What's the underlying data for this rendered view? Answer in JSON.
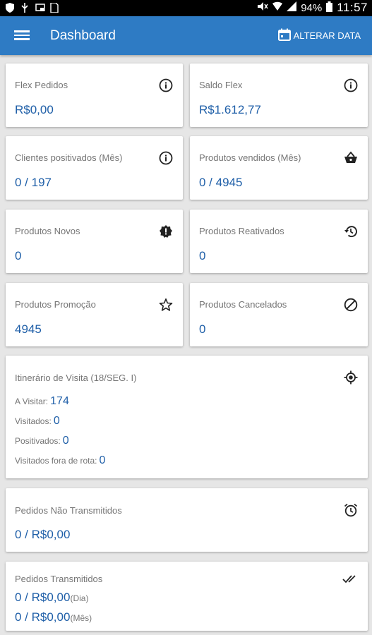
{
  "status_bar": {
    "battery": "94%",
    "time": "11:57"
  },
  "app_bar": {
    "title": "Dashboard",
    "change_date_label": "ALTERAR DATA"
  },
  "cards": {
    "flex_pedidos": {
      "title": "Flex Pedidos",
      "value": "R$0,00"
    },
    "saldo_flex": {
      "title": "Saldo Flex",
      "value": "R$1.612,77"
    },
    "clientes_positivados": {
      "title": "Clientes positivados (Mês)",
      "value": "0 / 197"
    },
    "produtos_vendidos": {
      "title": "Produtos vendidos (Mês)",
      "value": "0 / 4945"
    },
    "produtos_novos": {
      "title": "Produtos Novos",
      "value": "0"
    },
    "produtos_reativados": {
      "title": "Produtos Reativados",
      "value": "0"
    },
    "produtos_promocao": {
      "title": "Produtos Promoção",
      "value": "4945"
    },
    "produtos_cancelados": {
      "title": "Produtos Cancelados",
      "value": "0"
    }
  },
  "itinerario": {
    "title": "Itinerário de Visita (18/SEG. I)",
    "a_visitar_label": "A Visitar:",
    "a_visitar_value": "174",
    "visitados_label": "Visitados:",
    "visitados_value": "0",
    "positivados_label": "Positivados:",
    "positivados_value": "0",
    "fora_rota_label": "Visitados fora de rota:",
    "fora_rota_value": "0"
  },
  "pedidos_nao_transmitidos": {
    "title": "Pedidos Não Transmitidos",
    "value": "0 / R$0,00"
  },
  "pedidos_transmitidos": {
    "title": "Pedidos Transmitidos",
    "dia_value": "0 / R$0,00",
    "dia_suffix": "(Dia)",
    "mes_value": "0 / R$0,00",
    "mes_suffix": "(Mês)"
  },
  "colors": {
    "app_bar": "#2e7bc4",
    "value_text": "#1f5fa8",
    "background": "#e6e6e6"
  }
}
